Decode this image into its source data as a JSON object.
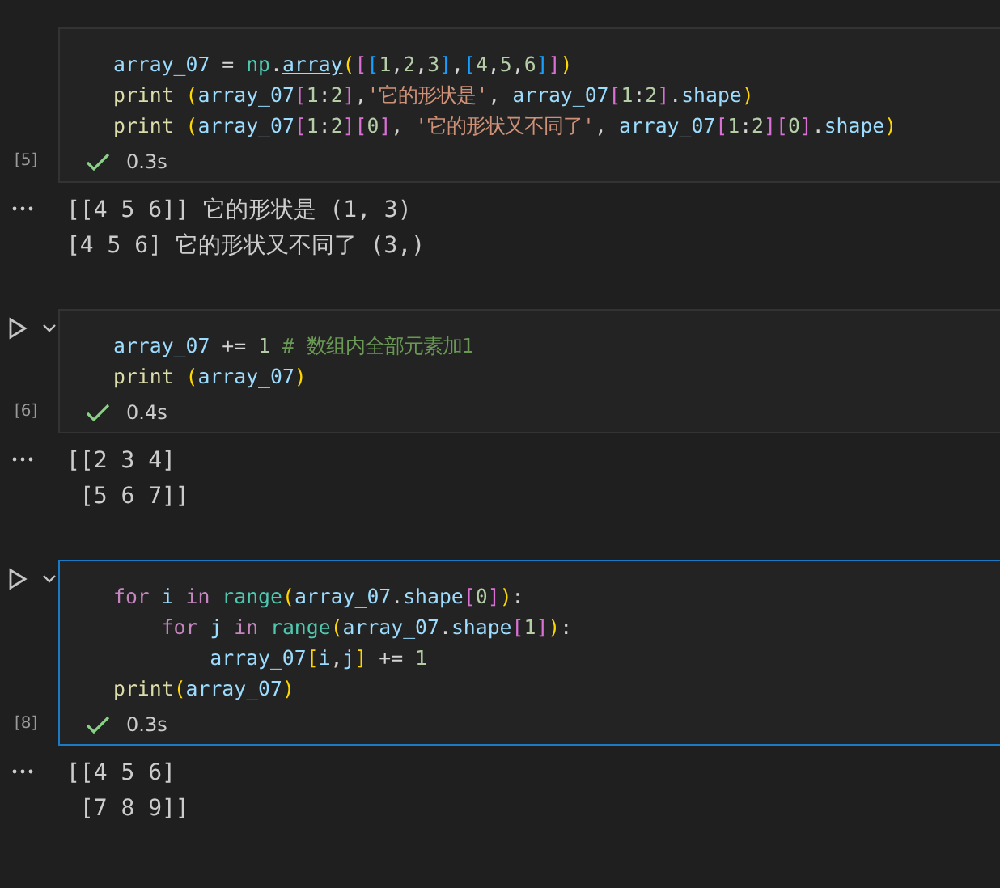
{
  "cells": [
    {
      "exec_count": "[5]",
      "selected": false,
      "run_button": false,
      "status": "0.3s",
      "code": [
        [
          {
            "kind": "var",
            "text": "array_07"
          },
          {
            "kind": "pl",
            "text": " = "
          },
          {
            "kind": "cls",
            "text": "np"
          },
          {
            "kind": "pl",
            "text": "."
          },
          {
            "kind": "link",
            "text": "array"
          },
          {
            "kind": "br1",
            "text": "("
          },
          {
            "kind": "br2",
            "text": "["
          },
          {
            "kind": "br3",
            "text": "["
          },
          {
            "kind": "num",
            "text": "1"
          },
          {
            "kind": "pl",
            "text": ","
          },
          {
            "kind": "num",
            "text": "2"
          },
          {
            "kind": "pl",
            "text": ","
          },
          {
            "kind": "num",
            "text": "3"
          },
          {
            "kind": "br3",
            "text": "]"
          },
          {
            "kind": "pl",
            "text": ","
          },
          {
            "kind": "br3",
            "text": "["
          },
          {
            "kind": "num",
            "text": "4"
          },
          {
            "kind": "pl",
            "text": ","
          },
          {
            "kind": "num",
            "text": "5"
          },
          {
            "kind": "pl",
            "text": ","
          },
          {
            "kind": "num",
            "text": "6"
          },
          {
            "kind": "br3",
            "text": "]"
          },
          {
            "kind": "br2",
            "text": "]"
          },
          {
            "kind": "br1",
            "text": ")"
          }
        ],
        [
          {
            "kind": "fn",
            "text": "print "
          },
          {
            "kind": "br1",
            "text": "("
          },
          {
            "kind": "var",
            "text": "array_07"
          },
          {
            "kind": "br2",
            "text": "["
          },
          {
            "kind": "num",
            "text": "1"
          },
          {
            "kind": "pl",
            "text": ":"
          },
          {
            "kind": "num",
            "text": "2"
          },
          {
            "kind": "br2",
            "text": "]"
          },
          {
            "kind": "pl",
            "text": ","
          },
          {
            "kind": "str",
            "text": "'它的形状是'"
          },
          {
            "kind": "pl",
            "text": ", "
          },
          {
            "kind": "var",
            "text": "array_07"
          },
          {
            "kind": "br2",
            "text": "["
          },
          {
            "kind": "num",
            "text": "1"
          },
          {
            "kind": "pl",
            "text": ":"
          },
          {
            "kind": "num",
            "text": "2"
          },
          {
            "kind": "br2",
            "text": "]"
          },
          {
            "kind": "pl",
            "text": "."
          },
          {
            "kind": "var",
            "text": "shape"
          },
          {
            "kind": "br1",
            "text": ")"
          }
        ],
        [
          {
            "kind": "fn",
            "text": "print "
          },
          {
            "kind": "br1",
            "text": "("
          },
          {
            "kind": "var",
            "text": "array_07"
          },
          {
            "kind": "br2",
            "text": "["
          },
          {
            "kind": "num",
            "text": "1"
          },
          {
            "kind": "pl",
            "text": ":"
          },
          {
            "kind": "num",
            "text": "2"
          },
          {
            "kind": "br2",
            "text": "]"
          },
          {
            "kind": "br2",
            "text": "["
          },
          {
            "kind": "num",
            "text": "0"
          },
          {
            "kind": "br2",
            "text": "]"
          },
          {
            "kind": "pl",
            "text": ", "
          },
          {
            "kind": "str",
            "text": "'它的形状又不同了'"
          },
          {
            "kind": "pl",
            "text": ", "
          },
          {
            "kind": "var",
            "text": "array_07"
          },
          {
            "kind": "br2",
            "text": "["
          },
          {
            "kind": "num",
            "text": "1"
          },
          {
            "kind": "pl",
            "text": ":"
          },
          {
            "kind": "num",
            "text": "2"
          },
          {
            "kind": "br2",
            "text": "]"
          },
          {
            "kind": "br2",
            "text": "["
          },
          {
            "kind": "num",
            "text": "0"
          },
          {
            "kind": "br2",
            "text": "]"
          },
          {
            "kind": "pl",
            "text": "."
          },
          {
            "kind": "var",
            "text": "shape"
          },
          {
            "kind": "br1",
            "text": ")"
          }
        ]
      ],
      "output": [
        "[[4 5 6]] 它的形状是 (1, 3)",
        "[4 5 6] 它的形状又不同了 (3,)"
      ]
    },
    {
      "exec_count": "[6]",
      "selected": false,
      "run_button": true,
      "status": "0.4s",
      "code": [
        [
          {
            "kind": "var",
            "text": "array_07"
          },
          {
            "kind": "pl",
            "text": " += "
          },
          {
            "kind": "num",
            "text": "1"
          },
          {
            "kind": "cmt",
            "text": " # 数组内全部元素加1"
          }
        ],
        [
          {
            "kind": "fn",
            "text": "print "
          },
          {
            "kind": "br1",
            "text": "("
          },
          {
            "kind": "var",
            "text": "array_07"
          },
          {
            "kind": "br1",
            "text": ")"
          }
        ]
      ],
      "output": [
        "[[2 3 4]",
        " [5 6 7]]"
      ]
    },
    {
      "exec_count": "[8]",
      "selected": true,
      "run_button": true,
      "status": "0.3s",
      "code": [
        [
          {
            "kind": "kw",
            "text": "for "
          },
          {
            "kind": "var",
            "text": "i "
          },
          {
            "kind": "kw",
            "text": "in "
          },
          {
            "kind": "cls",
            "text": "range"
          },
          {
            "kind": "br1",
            "text": "("
          },
          {
            "kind": "var",
            "text": "array_07"
          },
          {
            "kind": "pl",
            "text": "."
          },
          {
            "kind": "var",
            "text": "shape"
          },
          {
            "kind": "br2",
            "text": "["
          },
          {
            "kind": "num",
            "text": "0"
          },
          {
            "kind": "br2",
            "text": "]"
          },
          {
            "kind": "br1",
            "text": ")"
          },
          {
            "kind": "pl",
            "text": ":"
          }
        ],
        [
          {
            "kind": "kw",
            "text": "    for "
          },
          {
            "kind": "var",
            "text": "j "
          },
          {
            "kind": "kw",
            "text": "in "
          },
          {
            "kind": "cls",
            "text": "range"
          },
          {
            "kind": "br1",
            "text": "("
          },
          {
            "kind": "var",
            "text": "array_07"
          },
          {
            "kind": "pl",
            "text": "."
          },
          {
            "kind": "var",
            "text": "shape"
          },
          {
            "kind": "br2",
            "text": "["
          },
          {
            "kind": "num",
            "text": "1"
          },
          {
            "kind": "br2",
            "text": "]"
          },
          {
            "kind": "br1",
            "text": ")"
          },
          {
            "kind": "pl",
            "text": ":"
          }
        ],
        [
          {
            "kind": "var",
            "text": "        array_07"
          },
          {
            "kind": "br1",
            "text": "["
          },
          {
            "kind": "var",
            "text": "i"
          },
          {
            "kind": "pl",
            "text": ","
          },
          {
            "kind": "var",
            "text": "j"
          },
          {
            "kind": "br1",
            "text": "]"
          },
          {
            "kind": "pl",
            "text": " += "
          },
          {
            "kind": "num",
            "text": "1"
          }
        ],
        [
          {
            "kind": "fn",
            "text": "print"
          },
          {
            "kind": "br1",
            "text": "("
          },
          {
            "kind": "var",
            "text": "array_07"
          },
          {
            "kind": "br1",
            "text": ")"
          }
        ]
      ],
      "output": [
        "[[4 5 6]",
        " [7 8 9]]"
      ]
    }
  ]
}
